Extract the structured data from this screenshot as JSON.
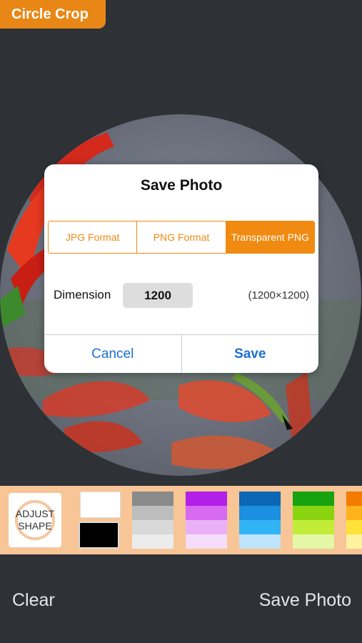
{
  "app": {
    "title": "Circle Crop"
  },
  "dialog": {
    "title": "Save Photo",
    "formats": [
      {
        "label": "JPG Format",
        "active": false
      },
      {
        "label": "PNG Format",
        "active": false
      },
      {
        "label": "Transparent PNG",
        "active": true
      }
    ],
    "dimension_label": "Dimension",
    "dimension_value": "1200",
    "dimension_size": "(1200×1200)",
    "cancel_label": "Cancel",
    "save_label": "Save"
  },
  "palette": {
    "adjust_line1": "ADJUST",
    "adjust_line2": "SHAPE",
    "accent": "#f08a10",
    "background": "#f7c596",
    "columns": [
      [
        "#8a8a8a",
        "#bdbdbd",
        "#d9d9d9",
        "#ececec"
      ],
      [
        "#b21fe8",
        "#d76af0",
        "#eab2f6",
        "#f6dcfb"
      ],
      [
        "#0b66b5",
        "#1b8fe0",
        "#31b4f5",
        "#bfe4fb"
      ],
      [
        "#17a30f",
        "#8ad40f",
        "#c2ec3a",
        "#e3f7a6"
      ],
      [
        "#f27b00",
        "#ffb21c",
        "#ffe13a",
        "#fff3a0"
      ]
    ]
  },
  "bottom": {
    "clear_label": "Clear",
    "save_photo_label": "Save Photo"
  }
}
